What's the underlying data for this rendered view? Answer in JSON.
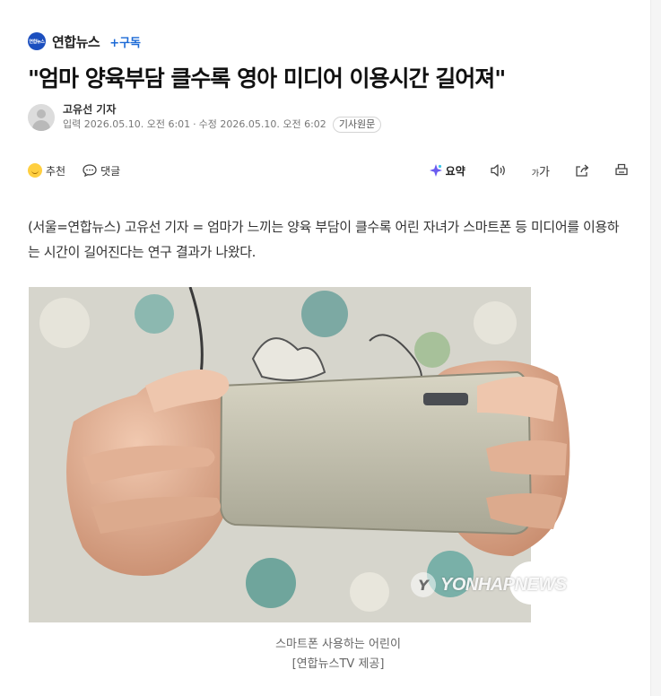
{
  "press": {
    "logo_text": "연합뉴스",
    "name": "연합뉴스",
    "subscribe_label": "+구독",
    "brand_color": "#1c4fbf"
  },
  "article": {
    "headline": "\"엄마 양육부담 클수록 영아 미디어 이용시간 길어져\"",
    "reporter": "고유선 기자",
    "published": "입력 2026.05.10. 오전 6:01",
    "separator": "·",
    "modified": "수정 2026.05.10. 오전 6:02",
    "original_label": "기사원문",
    "body": "(서울=연합뉴스) 고유선 기자 = 엄마가 느끼는 양육 부담이 클수록 어린 자녀가 스마트폰 등 미디어를 이용하는 시간이 길어진다는 연구 결과가 나왔다."
  },
  "toolbar": {
    "recommend_label": "추천",
    "comment_label": "댓글",
    "summary_label": "요약",
    "font_size_small": "가",
    "font_size_large": "가",
    "icons": [
      "smile-emoji-icon",
      "comment-icon",
      "ai-summary-icon",
      "audio-icon",
      "font-size-icon",
      "share-icon",
      "print-icon"
    ]
  },
  "photo": {
    "watermark_text": "YONHAPNEWS",
    "watermark_mark": "Y",
    "caption_line1": "스마트폰 사용하는 어린이",
    "caption_line2": "[연합뉴스TV 제공]"
  }
}
